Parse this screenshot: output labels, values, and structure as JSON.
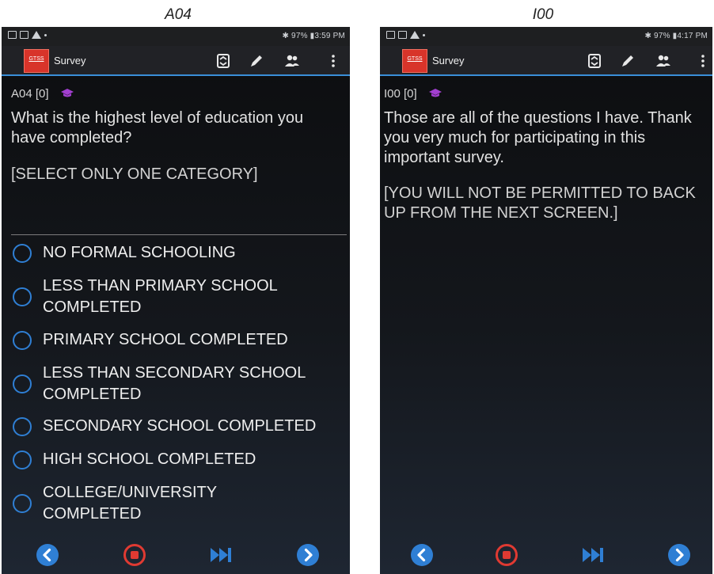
{
  "captions": {
    "left": "A04",
    "right": "I00"
  },
  "left_screen": {
    "status": {
      "right": "✱ 97% ▮3:59 PM"
    },
    "app_bar": {
      "logo": "GTSS",
      "title": "Survey"
    },
    "question": {
      "code": "A04  [0]",
      "text_line1": "What is the highest level of education you",
      "text_line2": "have completed?",
      "instruction": "[SELECT ONLY ONE CATEGORY]"
    },
    "options": [
      {
        "line1": "NO FORMAL SCHOOLING",
        "line2": ""
      },
      {
        "line1": "LESS THAN PRIMARY SCHOOL",
        "line2": "COMPLETED"
      },
      {
        "line1": "PRIMARY SCHOOL COMPLETED",
        "line2": ""
      },
      {
        "line1": "LESS THAN SECONDARY SCHOOL",
        "line2": "COMPLETED"
      },
      {
        "line1": "SECONDARY SCHOOL COMPLETED",
        "line2": ""
      },
      {
        "line1": "HIGH SCHOOL COMPLETED",
        "line2": ""
      },
      {
        "line1": "COLLEGE/UNIVERSITY",
        "line2": "COMPLETED"
      }
    ]
  },
  "right_screen": {
    "status": {
      "right": "✱ 97% ▮4:17 PM"
    },
    "app_bar": {
      "logo": "GTSS",
      "title": "Survey"
    },
    "question": {
      "code": "I00  [0]",
      "text_line1": "Those are all of the questions I have. Thank",
      "text_line2": "you very much for participating in this",
      "text_line3": "important survey.",
      "instruction_line1": "[YOU WILL NOT BE PERMITTED TO BACK",
      "instruction_line2": "UP FROM THE NEXT SCREEN.]"
    }
  },
  "colors": {
    "accent": "#2f7fd4",
    "stop": "#e03a32",
    "logo": "#d8342a",
    "cap_icon": "#a23fd0"
  },
  "icons": [
    "back-icon",
    "stop-icon",
    "skip-forward-icon",
    "next-icon",
    "swap-icon",
    "pencil-icon",
    "people-icon",
    "overflow-menu-icon",
    "graduation-cap-icon"
  ]
}
